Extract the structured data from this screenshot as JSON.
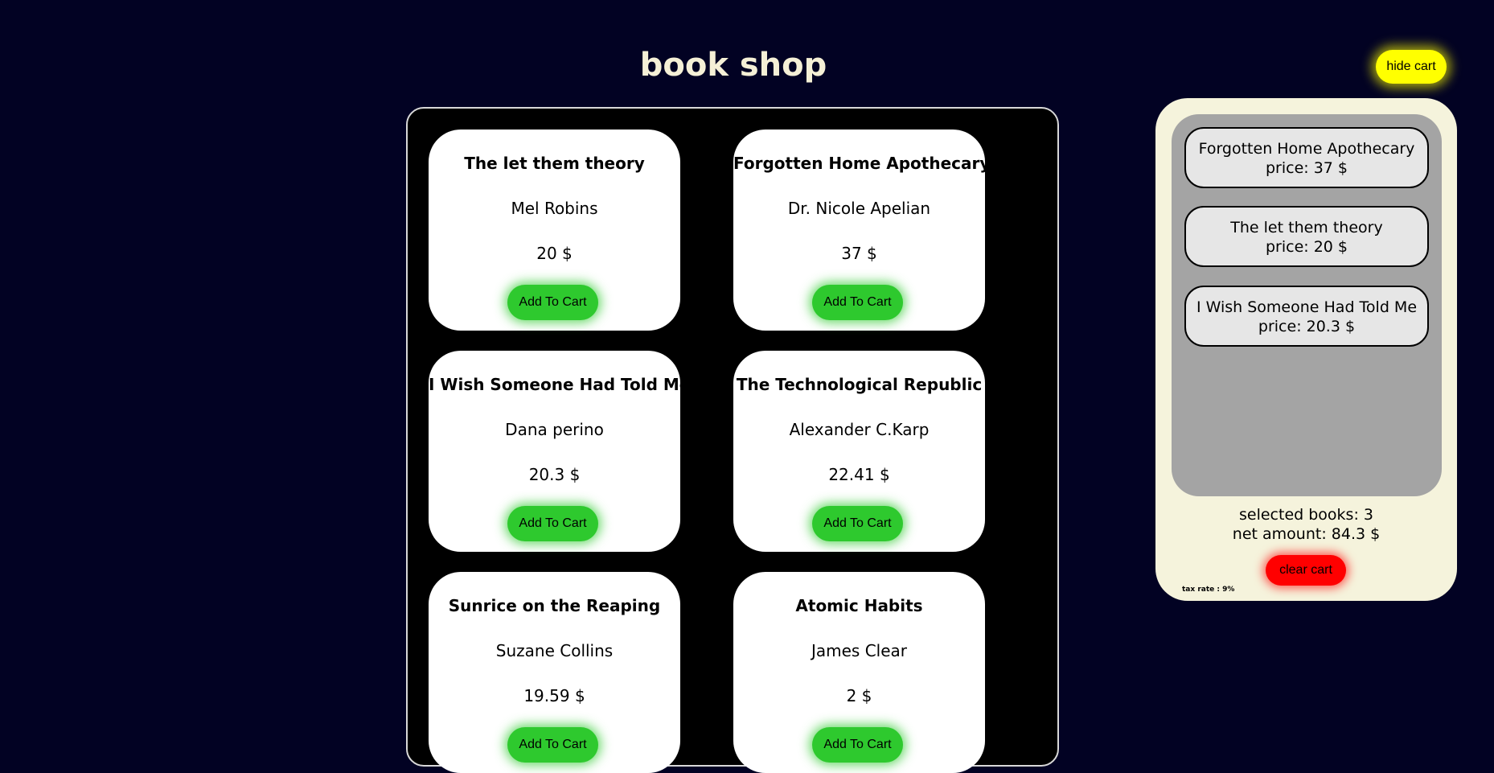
{
  "header": {
    "title": "book shop"
  },
  "books": [
    {
      "title": "The let them theory",
      "author": "Mel Robins",
      "price": "20 $",
      "button": "Add To Cart"
    },
    {
      "title": "Forgotten Home Apothecary",
      "author": "Dr. Nicole Apelian",
      "price": "37 $",
      "button": "Add To Cart"
    },
    {
      "title": "I Wish Someone Had Told Me",
      "author": "Dana perino",
      "price": "20.3 $",
      "button": "Add To Cart"
    },
    {
      "title": "The Technological Republic",
      "author": "Alexander C.Karp",
      "price": "22.41 $",
      "button": "Add To Cart"
    },
    {
      "title": "Sunrice on the Reaping",
      "author": "Suzane Collins",
      "price": "19.59 $",
      "button": "Add To Cart"
    },
    {
      "title": "Atomic Habits",
      "author": "James Clear",
      "price": "2 $",
      "button": "Add To Cart"
    }
  ],
  "cart": {
    "toggle_label": "hide cart",
    "items": [
      {
        "title": "Forgotten Home Apothecary",
        "price": "price: 37 $"
      },
      {
        "title": "The let them theory",
        "price": "price: 20 $"
      },
      {
        "title": "I Wish Someone Had Told Me",
        "price": "price: 20.3 $"
      }
    ],
    "selected": "selected books: 3",
    "net_amount": "net amount: 84.3 $",
    "clear_label": "clear cart",
    "tax_rate": "tax rate : 9%"
  },
  "colors": {
    "background": "#020223",
    "add_button": "#2ec92e",
    "hide_cart_button": "#ffff00",
    "clear_cart_button": "#ff0000",
    "cart_background": "#f5f3dc"
  }
}
